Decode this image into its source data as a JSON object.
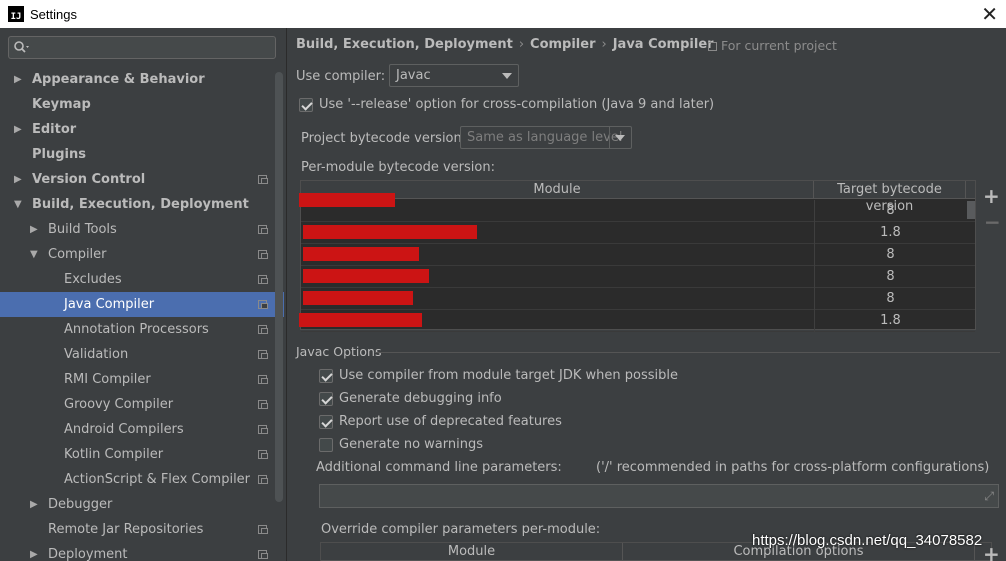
{
  "window": {
    "title": "Settings",
    "close_glyph": "✕",
    "icon_name": "intellij-icon",
    "icon_text": "IJ"
  },
  "search": {
    "placeholder": "",
    "icon": "search-icon"
  },
  "tree": [
    {
      "label": "Appearance & Behavior",
      "level": 0,
      "bold": true,
      "arrow": "right",
      "project": false,
      "selected": false
    },
    {
      "label": "Keymap",
      "level": 0,
      "bold": true,
      "arrow": "none",
      "project": false,
      "selected": false
    },
    {
      "label": "Editor",
      "level": 0,
      "bold": true,
      "arrow": "right",
      "project": false,
      "selected": false
    },
    {
      "label": "Plugins",
      "level": 0,
      "bold": true,
      "arrow": "none",
      "project": false,
      "selected": false
    },
    {
      "label": "Version Control",
      "level": 0,
      "bold": true,
      "arrow": "right",
      "project": true,
      "selected": false
    },
    {
      "label": "Build, Execution, Deployment",
      "level": 0,
      "bold": true,
      "arrow": "down",
      "project": false,
      "selected": false
    },
    {
      "label": "Build Tools",
      "level": 1,
      "bold": false,
      "arrow": "right",
      "project": true,
      "selected": false
    },
    {
      "label": "Compiler",
      "level": 1,
      "bold": false,
      "arrow": "down",
      "project": true,
      "selected": false
    },
    {
      "label": "Excludes",
      "level": 2,
      "bold": false,
      "arrow": "none",
      "project": true,
      "selected": false
    },
    {
      "label": "Java Compiler",
      "level": 2,
      "bold": false,
      "arrow": "none",
      "project": true,
      "selected": true
    },
    {
      "label": "Annotation Processors",
      "level": 2,
      "bold": false,
      "arrow": "none",
      "project": true,
      "selected": false
    },
    {
      "label": "Validation",
      "level": 2,
      "bold": false,
      "arrow": "none",
      "project": true,
      "selected": false
    },
    {
      "label": "RMI Compiler",
      "level": 2,
      "bold": false,
      "arrow": "none",
      "project": true,
      "selected": false
    },
    {
      "label": "Groovy Compiler",
      "level": 2,
      "bold": false,
      "arrow": "none",
      "project": true,
      "selected": false
    },
    {
      "label": "Android Compilers",
      "level": 2,
      "bold": false,
      "arrow": "none",
      "project": true,
      "selected": false
    },
    {
      "label": "Kotlin Compiler",
      "level": 2,
      "bold": false,
      "arrow": "none",
      "project": true,
      "selected": false
    },
    {
      "label": "ActionScript & Flex Compiler",
      "level": 2,
      "bold": false,
      "arrow": "none",
      "project": true,
      "selected": false
    },
    {
      "label": "Debugger",
      "level": 1,
      "bold": false,
      "arrow": "right",
      "project": false,
      "selected": false
    },
    {
      "label": "Remote Jar Repositories",
      "level": 1,
      "bold": false,
      "arrow": "none",
      "project": true,
      "selected": false
    },
    {
      "label": "Deployment",
      "level": 1,
      "bold": false,
      "arrow": "right",
      "project": true,
      "selected": false
    }
  ],
  "breadcrumb": {
    "items": [
      "Build, Execution, Deployment",
      "Java Compiler",
      "Compiler",
      "Java Compiler"
    ],
    "parts": [
      "Build, Execution, Deployment",
      "Compiler",
      "Java Compiler"
    ],
    "separator": "›",
    "scope": "For current project"
  },
  "compiler": {
    "use_compiler_label": "Use compiler:",
    "use_compiler_value": "Javac",
    "release_option_label": "Use '--release' option for cross-compilation (Java 9 and later)",
    "release_option_checked": true,
    "bytecode_label": "Project bytecode version:",
    "bytecode_value": "Same as language level",
    "per_module_label": "Per-module bytecode version:"
  },
  "module_table": {
    "headers": [
      "Module",
      "Target bytecode version"
    ],
    "rows": [
      {
        "module": "",
        "redacted": true,
        "version": "8"
      },
      {
        "module": "",
        "redacted": true,
        "version": "1.8"
      },
      {
        "module": "",
        "redacted": true,
        "version": "8"
      },
      {
        "module": "",
        "redacted": true,
        "version": "8"
      },
      {
        "module": "",
        "redacted": true,
        "version": "8"
      },
      {
        "module": "",
        "redacted": true,
        "version": "1.8"
      }
    ],
    "add_glyph": "+",
    "remove_glyph": "−"
  },
  "javac": {
    "group_title": "Javac Options",
    "options": [
      {
        "label": "Use compiler from module target JDK when possible",
        "checked": true
      },
      {
        "label": "Generate debugging info",
        "checked": true
      },
      {
        "label": "Report use of deprecated features",
        "checked": true
      },
      {
        "label": "Generate no warnings",
        "checked": false
      }
    ],
    "additional_label": "Additional command line parameters:",
    "additional_hint": "('/' recommended in paths for cross-platform configurations)",
    "additional_value": "",
    "override_label": "Override compiler parameters per-module:",
    "override_headers": [
      "Module",
      "Compilation options"
    ],
    "override_add_glyph": "+"
  },
  "watermark": "https://blog.csdn.net/qq_34078582",
  "colors": {
    "selection": "#4b6eaf",
    "background": "#3c3f41",
    "redaction": "#cc1414"
  }
}
